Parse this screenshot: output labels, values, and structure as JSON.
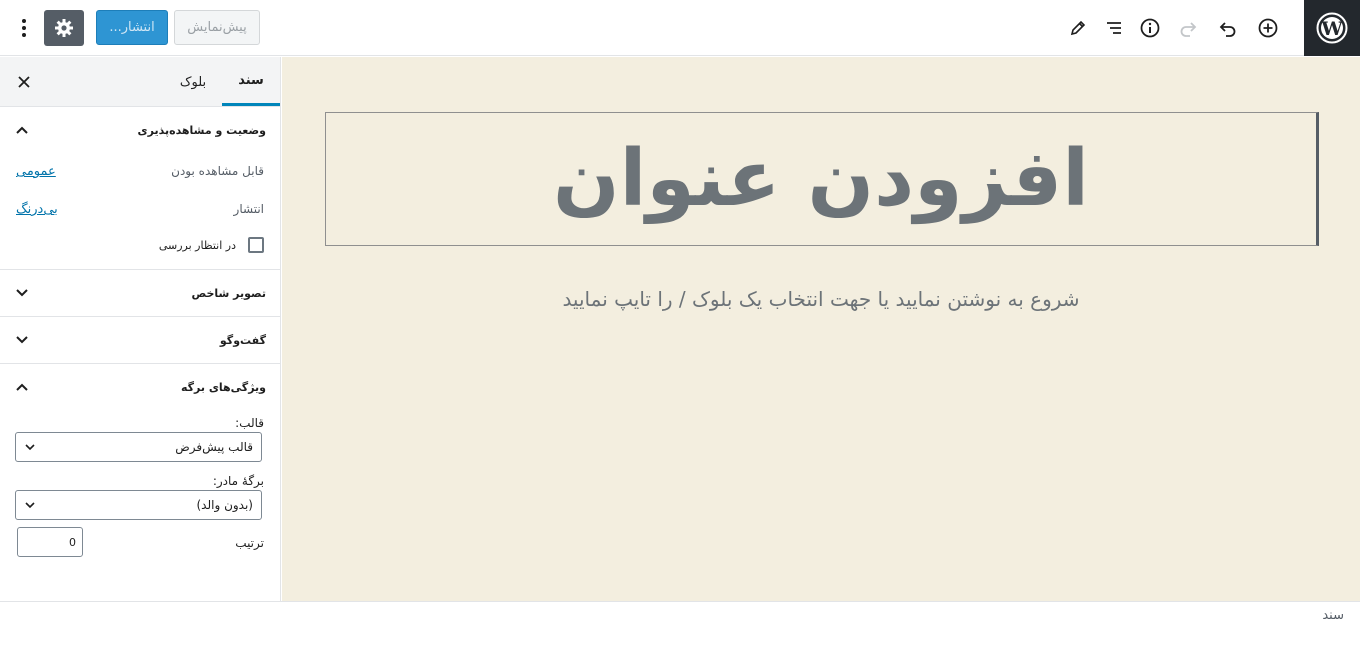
{
  "header": {
    "publish_label": "انتشار...",
    "preview_label": "پیش‌نمایش",
    "icons": [
      "wordpress-logo",
      "add-block-icon",
      "undo-icon",
      "redo-icon",
      "info-icon",
      "list-view-icon",
      "edit-tool-icon",
      "gear-icon",
      "more-vertical-icon"
    ]
  },
  "sidebar": {
    "tabs": [
      {
        "label": "سند"
      },
      {
        "label": "بلوک"
      }
    ],
    "status_panel": {
      "title": "وضعیت و مشاهده‌پذیری",
      "visibility_label": "قابل مشاهده بودن",
      "visibility_value": "عمومی",
      "publish_label": "انتشار",
      "publish_value": "بی‌درنگ",
      "pending_label": "در انتظار بررسی"
    },
    "featured_image_panel": {
      "title": "تصویر شاخص"
    },
    "discussion_panel": {
      "title": "گفت‌وگو"
    },
    "page_attributes_panel": {
      "title": "ویژگی‌های برگه",
      "template_label": "قالب:",
      "template_value": "قالب پیش‌فرض",
      "parent_label": "برگهٔ مادر:",
      "parent_value": "(بدون والد)",
      "order_label": "ترتیب",
      "order_value": "0"
    }
  },
  "editor": {
    "title_placeholder": "افزودن عنوان",
    "body_placeholder": "شروع به نوشتن نمایید یا جهت انتخاب یک بلوک / را تایپ نمایید"
  },
  "footer": {
    "breadcrumb": "سند"
  },
  "colors": {
    "accent": "#0085ba",
    "publish_button": "#2e95d3",
    "canvas_bg": "#f3eedf",
    "settings_button": "#555d66"
  }
}
